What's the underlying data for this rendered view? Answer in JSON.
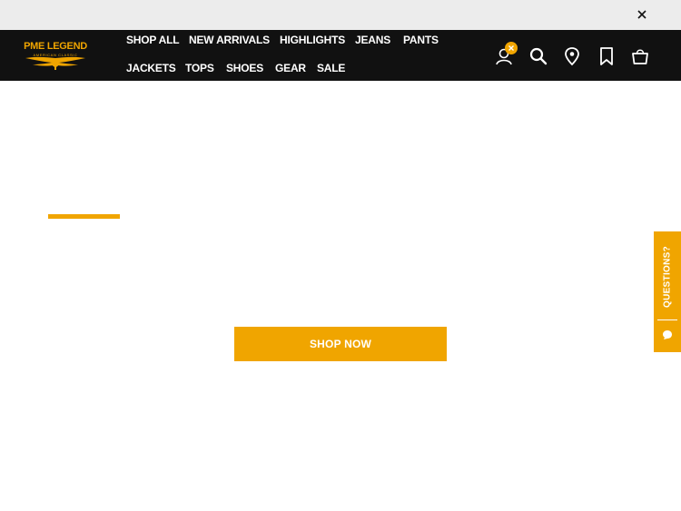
{
  "brand": {
    "name": "PME LEGEND",
    "tagline": "AMERICAN CLASSIC",
    "accent_color": "#f0a500",
    "header_bg": "#111111",
    "topbar_bg": "#ececec"
  },
  "nav": {
    "items": [
      {
        "label": "SHOP ALL"
      },
      {
        "label": "NEW ARRIVALS"
      },
      {
        "label": "HIGHLIGHTS"
      },
      {
        "label": "JEANS"
      },
      {
        "label": "PANTS"
      },
      {
        "label": "JACKETS"
      },
      {
        "label": "TOPS"
      },
      {
        "label": "SHOES"
      },
      {
        "label": "GEAR"
      },
      {
        "label": "SALE"
      }
    ]
  },
  "header_icons": [
    "account-icon",
    "search-icon",
    "store-locator-icon",
    "wishlist-icon",
    "cart-icon"
  ],
  "hero": {
    "cta_label": "SHOP NOW"
  },
  "questions_tab": {
    "label": "QUESTIONS?"
  }
}
